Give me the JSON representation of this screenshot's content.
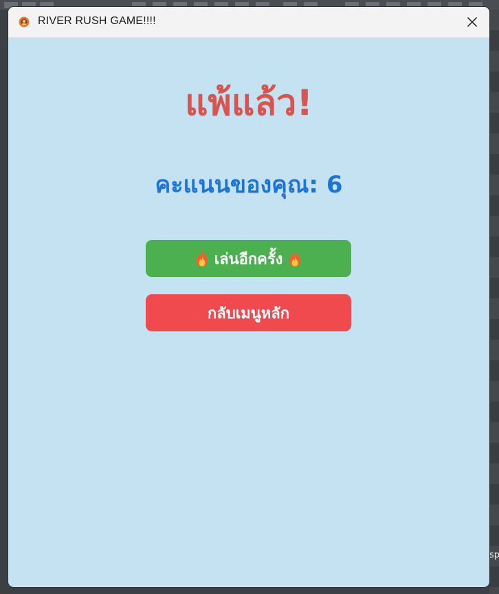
{
  "window": {
    "title": "RIVER RUSH GAME!!!!",
    "app_icon": "game-icon",
    "close_icon": "close-icon"
  },
  "game_over": {
    "heading": "แพ้แล้ว!",
    "score_text": "คะแนนของคุณ: 6",
    "buttons": {
      "play_again_label": "เล่นอีกครั้ง",
      "play_again_icon": "fire-emoji",
      "main_menu_label": "กลับเมนูหลัก"
    }
  },
  "colors": {
    "background": "#c5e2f2",
    "heading": "#d9534f",
    "score": "#1e74d6",
    "play_again": "#4cb051",
    "main_menu": "#f04a4f"
  },
  "background_app": {
    "edge_text": "sp"
  }
}
